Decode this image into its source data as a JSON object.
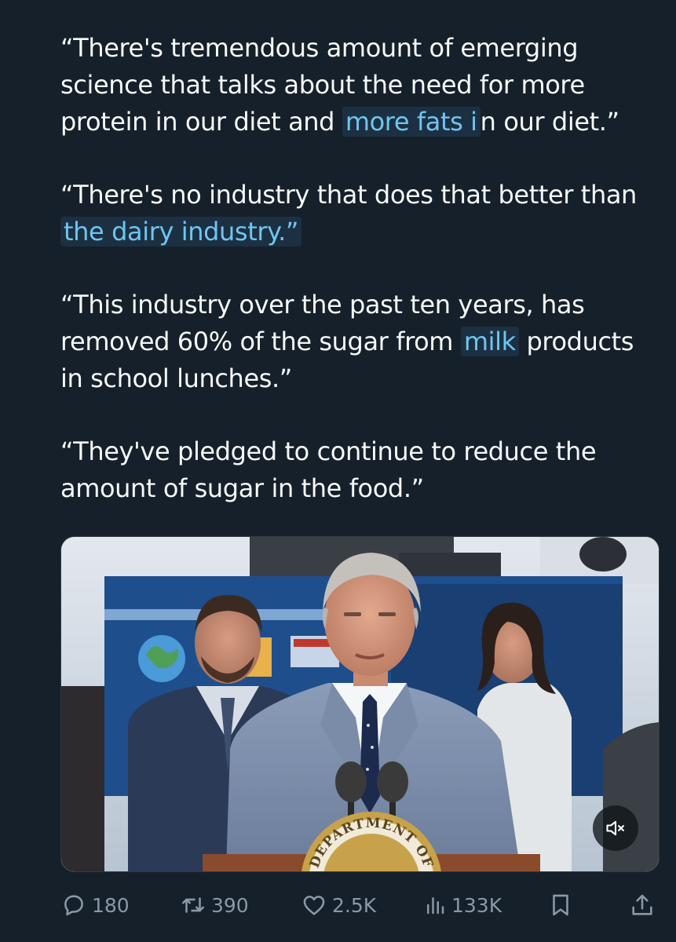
{
  "post": {
    "paragraphs": [
      {
        "parts": [
          {
            "text": "“There's tremendous amount of emerging science that talks about the need for more protein in our diet and ",
            "highlight": false
          },
          {
            "text": "more fats i",
            "highlight": true
          },
          {
            "text": "n our diet.”",
            "highlight": false
          }
        ]
      },
      {
        "parts": [
          {
            "text": "“There's no industry that does that better than ",
            "highlight": false
          },
          {
            "text": "the dairy industry.”",
            "highlight": true
          }
        ]
      },
      {
        "parts": [
          {
            "text": "“This industry over the past ten years, has removed 60% of the sugar from ",
            "highlight": false
          },
          {
            "text": "milk",
            "highlight": true
          },
          {
            "text": " products in school lunches.”",
            "highlight": false
          }
        ]
      },
      {
        "parts": [
          {
            "text": "“They've pledged to continue to reduce the amount of sugar in the food.”",
            "highlight": false
          }
        ]
      }
    ]
  },
  "media": {
    "type": "video",
    "podium_seal_text": "DEPARTMENT OF",
    "mute_icon": "speaker-muted-icon"
  },
  "actions": {
    "reply_count": "180",
    "repost_count": "390",
    "like_count": "2.5K",
    "view_count": "133K"
  },
  "colors": {
    "background": "#15202b",
    "text": "#f7f9f9",
    "highlight_text": "#6ec6f1",
    "highlight_bg": "#1d3042",
    "secondary": "#8b98a5"
  }
}
